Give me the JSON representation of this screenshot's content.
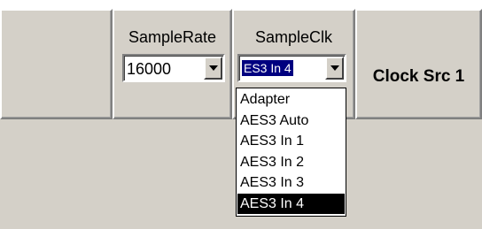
{
  "sample_rate": {
    "label": "SampleRate",
    "value": "16000"
  },
  "sample_clk": {
    "label": "SampleClk",
    "value": "ES3 In 4",
    "options": [
      "Adapter",
      "AES3 Auto",
      "AES3 In 1",
      "AES3 In 2",
      "AES3 In 3",
      "AES3 In 4"
    ],
    "selected_index": 5
  },
  "clock_src": {
    "label": "Clock Src 1"
  },
  "colors": {
    "face": "#d4d0c8",
    "highlight": "#ffffff",
    "shadow": "#808080",
    "selection": "#000080",
    "dropdown_selection": "#000000"
  },
  "icons": {
    "dropdown_arrow": "chevron-down-icon"
  }
}
